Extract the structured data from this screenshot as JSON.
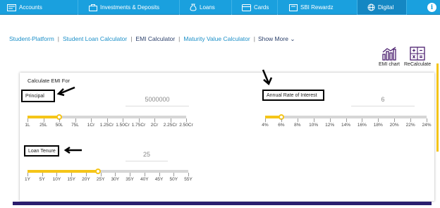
{
  "topnav": {
    "items": [
      {
        "label": "Accounts",
        "icon": "accounts-icon"
      },
      {
        "label": "Investments & Deposits",
        "icon": "investments-icon"
      },
      {
        "label": "Loans",
        "icon": "loans-icon"
      },
      {
        "label": "Cards",
        "icon": "cards-icon"
      },
      {
        "label": "SBI Rewardz",
        "icon": "rewardz-icon"
      },
      {
        "label": "Digital",
        "icon": "digital-icon"
      }
    ],
    "info_glyph": "i",
    "active": "Digital"
  },
  "subnav": {
    "links": [
      "Student-Platform",
      "Student Loan Calculator",
      "EMI Calculator",
      "Maturity Value Calculator"
    ],
    "current": "EMI Calculator",
    "separator": "|",
    "show_more": "Show More"
  },
  "tools": {
    "emi_chart": "EMI chart",
    "recalculate": "ReCalculate"
  },
  "calculator": {
    "title": "Calculate EMI For",
    "principal": {
      "label": "Principal",
      "value": "5000000",
      "fraction": 0.2,
      "ticks": [
        "1L",
        "25L",
        "50L",
        "75L",
        "1Cr",
        "1.25Cr",
        "1.50Cr",
        "1.75Cr",
        "2Cr",
        "2.25Cr",
        "2.50Cr"
      ]
    },
    "rate": {
      "label": "Annual Rate of Interest",
      "value": "6",
      "fraction": 0.1,
      "ticks": [
        "4%",
        "6%",
        "8%",
        "10%",
        "12%",
        "14%",
        "16%",
        "18%",
        "20%",
        "22%",
        "24%"
      ]
    },
    "tenure": {
      "label": "Loan Tenure",
      "value": "25",
      "fraction": 0.44,
      "ticks": [
        "1Y",
        "5Y",
        "10Y",
        "15Y",
        "20Y",
        "25Y",
        "30Y",
        "35Y",
        "40Y",
        "45Y",
        "50Y",
        "55Y"
      ]
    }
  },
  "colors": {
    "nav": "#1aa0de",
    "slider_fill": "#f5c518",
    "link": "#1b8fc8",
    "footer": "#2b1d6e"
  }
}
